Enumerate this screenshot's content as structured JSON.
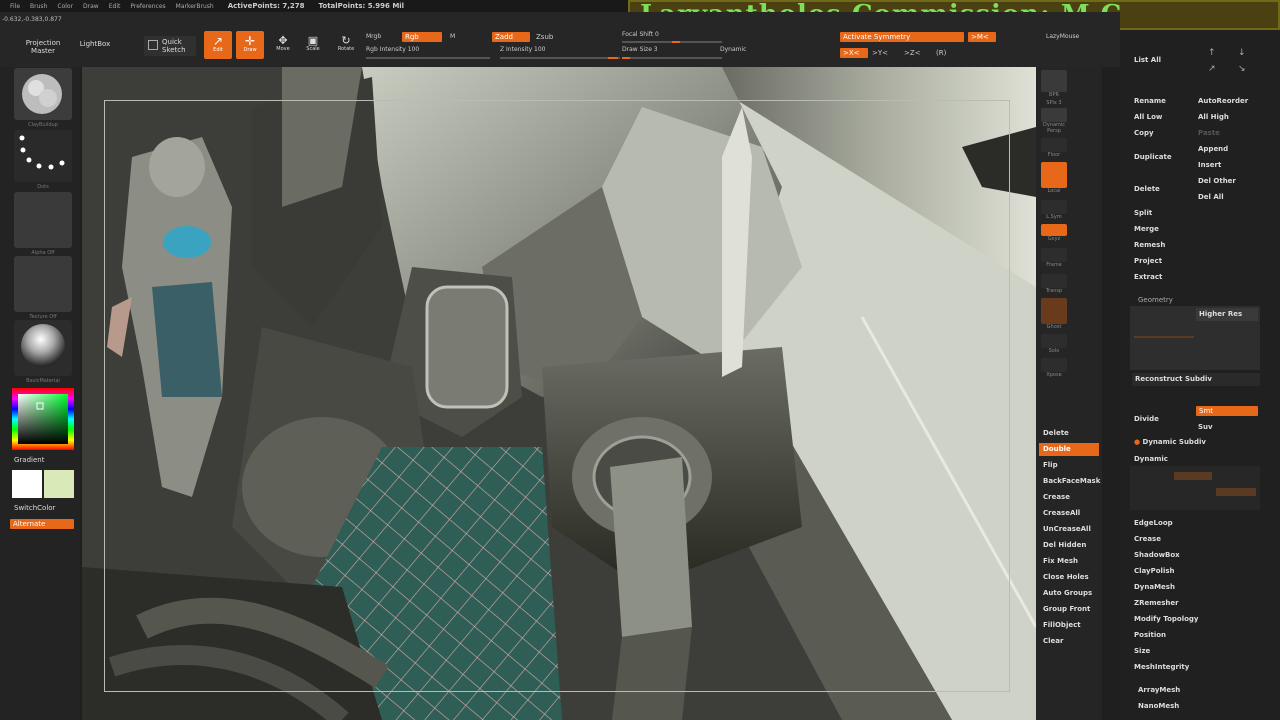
{
  "menu": {
    "items": [
      "File",
      "Brush",
      "Color",
      "Draw",
      "Edit",
      "Preferences",
      "MarkerBrush"
    ],
    "active_points": "ActivePoints: 7,278",
    "total_points": "TotalPoints: 5.996 Mil"
  },
  "title_banner": "Larvantholos Commission: M C",
  "coords": "-0.632,-0.383,0.877",
  "toolbar": {
    "projection_master": "Projection Master",
    "lightbox": "LightBox",
    "quick_sketch": "Quick Sketch",
    "edit": "Edit",
    "draw": "Draw",
    "move": "Move",
    "scale": "Scale",
    "rotate": "Rotate",
    "mrgb": "Mrgb",
    "rgb": "Rgb",
    "m": "M",
    "rgb_intensity": "Rgb Intensity 100",
    "zadd": "Zadd",
    "zsub": "Zsub",
    "z_intensity": "Z Intensity 100",
    "focal_shift": "Focal Shift 0",
    "draw_size": "Draw Size 3",
    "dynamic": "Dynamic",
    "activate_symmetry": "Activate Symmetry",
    "sym_x": ">X<",
    "sym_y": ">Y<",
    "sym_z": ">Z<",
    "sym_r": "(R)",
    "sym_m": ">M<",
    "lazymouse": "LazyMouse"
  },
  "left_shelf": {
    "brush_label": "ClayBuildup",
    "stroke_label": "Dots",
    "alpha_label": "Alpha Off",
    "texture_label": "Texture Off",
    "material_label": "BasicMaterial",
    "gradient": "Gradient",
    "switch_color": "SwitchColor",
    "alternate": "Alternate",
    "colors": {
      "primary": "#ffffff",
      "secondary": "#d9eab8"
    }
  },
  "right_shelf": {
    "icons": [
      "BPR",
      "SPix 3",
      "Dynamic Persp",
      "Floor",
      "Local",
      "L.Sym",
      "Gxyz",
      "Frame",
      "Transp",
      "Ghost",
      "Solo",
      "Xpose"
    ],
    "buttons": [
      "Delete",
      "Double",
      "Flip",
      "BackFaceMask",
      "Crease",
      "CreaseAll",
      "UnCreaseAll",
      "Del Hidden",
      "Fix Mesh",
      "Close Holes",
      "Auto Groups",
      "Group Front",
      "FillObject",
      "Clear"
    ],
    "active_button": "Double"
  },
  "palette": {
    "list_all": "List All",
    "rename": "Rename",
    "auto_reorder": "AutoReorder",
    "all_low": "All Low",
    "all_high": "All High",
    "copy": "Copy",
    "paste": "Paste",
    "duplicate": "Duplicate",
    "append": "Append",
    "insert": "Insert",
    "delete": "Delete",
    "del_other": "Del Other",
    "del_all": "Del All",
    "split": "Split",
    "merge": "Merge",
    "remesh": "Remesh",
    "project": "Project",
    "extract": "Extract",
    "geometry": "Geometry",
    "higher_res": "Higher Res",
    "reconstruct_subdiv": "Reconstruct Subdiv",
    "divide": "Divide",
    "smt": "Smt",
    "suv": "Suv",
    "dynamic_subdiv": "Dynamic Subdiv",
    "dynamic": "Dynamic",
    "edgeloop": "EdgeLoop",
    "crease": "Crease",
    "shadowbox": "ShadowBox",
    "claypolish": "ClayPolish",
    "dynamesh": "DynaMesh",
    "zremesher": "ZRemesher",
    "modify_topology": "Modify Topology",
    "position": "Position",
    "size": "Size",
    "meshintegrity": "MeshIntegrity",
    "arraymesh": "ArrayMesh",
    "nanomesh": "NanoMesh"
  },
  "colors": {
    "accent": "#e8681a",
    "banner_text": "#7ee05a"
  }
}
